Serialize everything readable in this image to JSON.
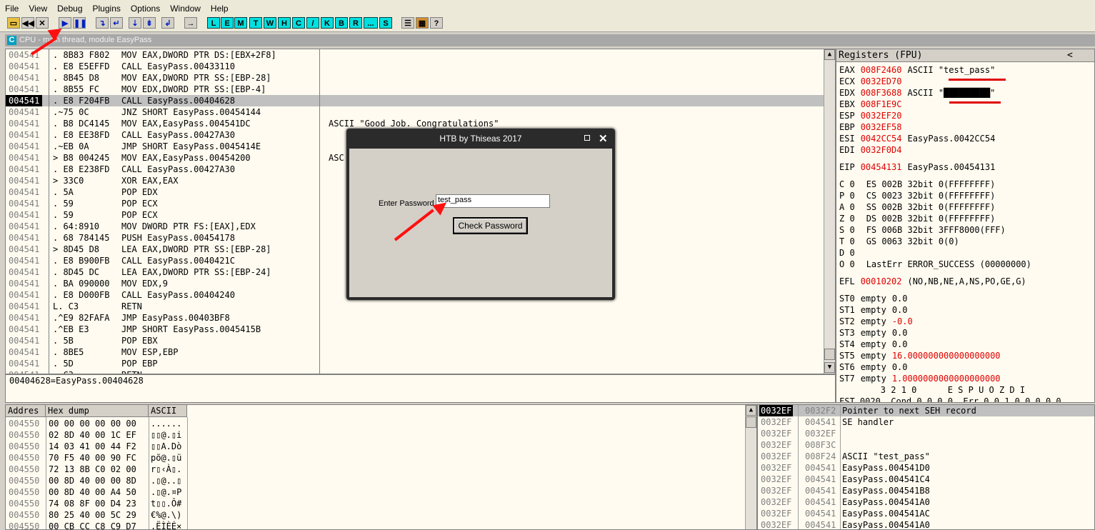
{
  "menu": [
    "File",
    "View",
    "Debug",
    "Plugins",
    "Options",
    "Window",
    "Help"
  ],
  "toolbar_letters": [
    "L",
    "E",
    "M",
    "T",
    "W",
    "H",
    "C",
    "/",
    "K",
    "B",
    "R",
    "...",
    "S"
  ],
  "cpu_window_title": "CPU - main thread, module EasyPass",
  "disasm": [
    {
      "addr": "004541",
      "hex": ". 8B83 F802",
      "asm": "MOV EAX,DWORD PTR DS:[EBX+2F8]",
      "comment": ""
    },
    {
      "addr": "004541",
      "hex": ". E8 E5EFFD",
      "asm": "CALL EasyPass.00433110",
      "comment": ""
    },
    {
      "addr": "004541",
      "hex": ". 8B45 D8",
      "asm": "MOV EAX,DWORD PTR SS:[EBP-28]",
      "comment": ""
    },
    {
      "addr": "004541",
      "hex": ". 8B55 FC",
      "asm": "MOV EDX,DWORD PTR SS:[EBP-4]",
      "comment": ""
    },
    {
      "addr": "004541",
      "hex": ". E8 F204FB",
      "asm": "CALL EasyPass.00404628",
      "comment": ""
    },
    {
      "addr": "004541",
      "hex": ".~75 0C",
      "asm": "JNZ SHORT EasyPass.00454144",
      "comment": ""
    },
    {
      "addr": "004541",
      "hex": ". B8 DC4145",
      "asm": "MOV EAX,EasyPass.004541DC",
      "comment": "ASCII \"Good Job. Congratulations\""
    },
    {
      "addr": "004541",
      "hex": ". E8 EE38FD",
      "asm": "CALL EasyPass.00427A30",
      "comment": ""
    },
    {
      "addr": "004541",
      "hex": ".~EB 0A",
      "asm": "JMP SHORT EasyPass.0045414E",
      "comment": ""
    },
    {
      "addr": "004541",
      "hex": "> B8 004245",
      "asm": "MOV EAX,EasyPass.00454200",
      "comment": "ASC"
    },
    {
      "addr": "004541",
      "hex": ". E8 E238FD",
      "asm": "CALL EasyPass.00427A30",
      "comment": ""
    },
    {
      "addr": "004541",
      "hex": "> 33C0",
      "asm": "XOR EAX,EAX",
      "comment": ""
    },
    {
      "addr": "004541",
      "hex": ". 5A",
      "asm": "POP EDX",
      "comment": ""
    },
    {
      "addr": "004541",
      "hex": ". 59",
      "asm": "POP ECX",
      "comment": ""
    },
    {
      "addr": "004541",
      "hex": ". 59",
      "asm": "POP ECX",
      "comment": ""
    },
    {
      "addr": "004541",
      "hex": ". 64:8910",
      "asm": "MOV DWORD PTR FS:[EAX],EDX",
      "comment": ""
    },
    {
      "addr": "004541",
      "hex": ". 68 784145",
      "asm": "PUSH EasyPass.00454178",
      "comment": ""
    },
    {
      "addr": "004541",
      "hex": "> 8D45 D8",
      "asm": "LEA EAX,DWORD PTR SS:[EBP-28]",
      "comment": ""
    },
    {
      "addr": "004541",
      "hex": ". E8 B900FB",
      "asm": "CALL EasyPass.0040421C",
      "comment": ""
    },
    {
      "addr": "004541",
      "hex": ". 8D45 DC",
      "asm": "LEA EAX,DWORD PTR SS:[EBP-24]",
      "comment": ""
    },
    {
      "addr": "004541",
      "hex": ". BA 090000",
      "asm": "MOV EDX,9",
      "comment": ""
    },
    {
      "addr": "004541",
      "hex": ". E8 D000FB",
      "asm": "CALL EasyPass.00404240",
      "comment": ""
    },
    {
      "addr": "004541",
      "hex": "L. C3",
      "asm": "RETN",
      "comment": ""
    },
    {
      "addr": "004541",
      "hex": ".^E9 82FAFA",
      "asm": "JMP EasyPass.00403BF8",
      "comment": ""
    },
    {
      "addr": "004541",
      "hex": ".^EB E3",
      "asm": "JMP SHORT EasyPass.0045415B",
      "comment": ""
    },
    {
      "addr": "004541",
      "hex": ". 5B",
      "asm": "POP EBX",
      "comment": ""
    },
    {
      "addr": "004541",
      "hex": ". 8BE5",
      "asm": "MOV ESP,EBP",
      "comment": ""
    },
    {
      "addr": "004541",
      "hex": ". 5D",
      "asm": "POP EBP",
      "comment": ""
    },
    {
      "addr": "004541",
      "hex": ". C3",
      "asm": "RETN",
      "comment": ""
    }
  ],
  "info_line": "00404628=EasyPass.00404628",
  "registers": {
    "title": "Registers (FPU)",
    "collapse": "<",
    "gp": [
      {
        "name": "EAX",
        "val": "008F2460",
        "note": "ASCII \"test_pass\""
      },
      {
        "name": "ECX",
        "val": "0032ED70",
        "note": ""
      },
      {
        "name": "EDX",
        "val": "008F3688",
        "note": "ASCII \"█████████\""
      },
      {
        "name": "EBX",
        "val": "008F1E9C",
        "note": ""
      },
      {
        "name": "ESP",
        "val": "0032EF20",
        "note": ""
      },
      {
        "name": "EBP",
        "val": "0032EF58",
        "note": ""
      },
      {
        "name": "ESI",
        "val": "0042CC54",
        "note": "EasyPass.0042CC54"
      },
      {
        "name": "EDI",
        "val": "0032F0D4",
        "note": ""
      }
    ],
    "eip": {
      "name": "EIP",
      "val": "00454131",
      "note": "EasyPass.00454131"
    },
    "flags": [
      {
        "f": "C 0",
        "seg": "ES 002B 32bit 0(FFFFFFFF)"
      },
      {
        "f": "P 0",
        "seg": "CS 0023 32bit 0(FFFFFFFF)"
      },
      {
        "f": "A 0",
        "seg": "SS 002B 32bit 0(FFFFFFFF)"
      },
      {
        "f": "Z 0",
        "seg": "DS 002B 32bit 0(FFFFFFFF)"
      },
      {
        "f": "S 0",
        "seg": "FS 006B 32bit 3FFF8000(FFF)"
      },
      {
        "f": "T 0",
        "seg": "GS 0063 32bit 0(0)"
      },
      {
        "f": "D 0",
        "seg": ""
      },
      {
        "f": "O 0",
        "seg": "LastErr ERROR_SUCCESS (00000000)"
      }
    ],
    "efl": {
      "name": "EFL",
      "val": "00010202",
      "note": "(NO,NB,NE,A,NS,PO,GE,G)"
    },
    "fpu": [
      {
        "name": "ST0",
        "state": "empty",
        "val": "0.0",
        "red": false
      },
      {
        "name": "ST1",
        "state": "empty",
        "val": "0.0",
        "red": false
      },
      {
        "name": "ST2",
        "state": "empty",
        "val": "-0.0",
        "red": true
      },
      {
        "name": "ST3",
        "state": "empty",
        "val": "0.0",
        "red": false
      },
      {
        "name": "ST4",
        "state": "empty",
        "val": "0.0",
        "red": false
      },
      {
        "name": "ST5",
        "state": "empty",
        "val": "16.000000000000000000",
        "red": true
      },
      {
        "name": "ST6",
        "state": "empty",
        "val": "0.0",
        "red": false
      },
      {
        "name": "ST7",
        "state": "empty",
        "val": "1.0000000000000000000",
        "red": true
      }
    ],
    "fpu_header": "        3 2 1 0      E S P U O Z D I",
    "fst": "FST 0020  Cond 0 0 0 0  Err 0 0 1 0 0 0 0 0"
  },
  "dump": {
    "headers": [
      "Addres",
      "Hex dump",
      "ASCII"
    ],
    "rows": [
      {
        "addr": "004550",
        "hex": "00 00 00 00 00 00",
        "ascii": "......"
      },
      {
        "addr": "004550",
        "hex": "02 8D 40 00 1C EF",
        "ascii": "▯▯@.▯i"
      },
      {
        "addr": "004550",
        "hex": "14 03 41 00 44 F2",
        "ascii": "▯▯A.Dò"
      },
      {
        "addr": "004550",
        "hex": "70 F5 40 00 90 FC",
        "ascii": "põ@.▯ü"
      },
      {
        "addr": "004550",
        "hex": "72 13 8B C0 02 00",
        "ascii": "r▯‹À▯."
      },
      {
        "addr": "004550",
        "hex": "00 8D 40 00 00 8D",
        "ascii": ".▯@..▯"
      },
      {
        "addr": "004550",
        "hex": "00 8D 40 00 A4 50",
        "ascii": ".▯@.¤P"
      },
      {
        "addr": "004550",
        "hex": "74 08 8F 00 D4 23",
        "ascii": "t▯▯.Ô#"
      },
      {
        "addr": "004550",
        "hex": "80 25 40 00 5C 29",
        "ascii": "€%@.\\)"
      },
      {
        "addr": "004550",
        "hex": "00 CB CC C8 C9 D7",
        "ascii": ".ËÌÈÉ×"
      }
    ]
  },
  "stack": [
    {
      "addr": "0032EF",
      "val": "0032F2",
      "note": "Pointer to next SEH record"
    },
    {
      "addr": "0032EF",
      "val": "004541",
      "note": "SE handler"
    },
    {
      "addr": "0032EF",
      "val": "0032EF",
      "note": ""
    },
    {
      "addr": "0032EF",
      "val": "008F3C",
      "note": ""
    },
    {
      "addr": "0032EF",
      "val": "008F24",
      "note": "ASCII \"test_pass\""
    },
    {
      "addr": "0032EF",
      "val": "004541",
      "note": "EasyPass.004541D0"
    },
    {
      "addr": "0032EF",
      "val": "004541",
      "note": "EasyPass.004541C4"
    },
    {
      "addr": "0032EF",
      "val": "004541",
      "note": "EasyPass.004541B8"
    },
    {
      "addr": "0032EF",
      "val": "004541",
      "note": "EasyPass.004541A0"
    },
    {
      "addr": "0032EF",
      "val": "004541",
      "note": "EasyPass.004541AC"
    },
    {
      "addr": "0032EF",
      "val": "004541",
      "note": "EasyPass.004541A0"
    }
  ],
  "dialog": {
    "title": "HTB by Thiseas 2017",
    "label": "Enter Password",
    "input_value": "test_pass",
    "button": "Check Password"
  }
}
